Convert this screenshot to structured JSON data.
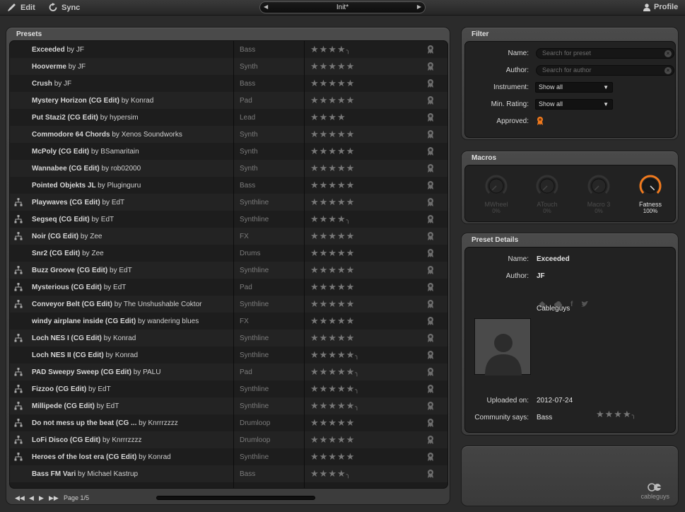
{
  "topbar": {
    "edit_label": "Edit",
    "sync_label": "Sync",
    "preset_name": "Init*",
    "profile_label": "Profile"
  },
  "presets": {
    "title": "Presets",
    "rows": [
      {
        "name": "Exceeded",
        "author": "by JF",
        "instrument": "Bass",
        "stars": "★★★★",
        "half": true,
        "tree": false
      },
      {
        "name": "Hooverme",
        "author": "by JF",
        "instrument": "Synth",
        "stars": "★★★★★",
        "half": false,
        "tree": false
      },
      {
        "name": "Crush",
        "author": "by JF",
        "instrument": "Bass",
        "stars": "★★★★★",
        "half": false,
        "tree": false
      },
      {
        "name": "Mystery Horizon (CG Edit)",
        "author": "by Konrad",
        "instrument": "Pad",
        "stars": "★★★★★",
        "half": false,
        "tree": false
      },
      {
        "name": "Put Stazi2 (CG Edit)",
        "author": "by hypersim",
        "instrument": "Lead",
        "stars": "★★★★",
        "half": false,
        "tree": false
      },
      {
        "name": "Commodore 64 Chords",
        "author": "by Xenos Soundworks",
        "instrument": "Synth",
        "stars": "★★★★★",
        "half": false,
        "tree": false
      },
      {
        "name": "McPoly (CG Edit)",
        "author": "by BSamaritain",
        "instrument": "Synth",
        "stars": "★★★★★",
        "half": false,
        "tree": false
      },
      {
        "name": "Wannabee (CG Edit)",
        "author": "by rob02000",
        "instrument": "Synth",
        "stars": "★★★★★",
        "half": false,
        "tree": false
      },
      {
        "name": "Pointed Objekts JL",
        "author": "by Pluginguru",
        "instrument": "Bass",
        "stars": "★★★★★",
        "half": false,
        "tree": false
      },
      {
        "name": "Playwaves (CG Edit)",
        "author": "by EdT",
        "instrument": "Synthline",
        "stars": "★★★★★",
        "half": false,
        "tree": true
      },
      {
        "name": "Segseq (CG Edit)",
        "author": "by EdT",
        "instrument": "Synthline",
        "stars": "★★★★",
        "half": true,
        "tree": true
      },
      {
        "name": "Noir (CG Edit)",
        "author": "by Zee",
        "instrument": "FX",
        "stars": "★★★★★",
        "half": false,
        "tree": true
      },
      {
        "name": "Snr2 (CG Edit)",
        "author": "by Zee",
        "instrument": "Drums",
        "stars": "★★★★★",
        "half": false,
        "tree": false
      },
      {
        "name": "Buzz Groove (CG Edit)",
        "author": "by EdT",
        "instrument": "Synthline",
        "stars": "★★★★★",
        "half": false,
        "tree": true
      },
      {
        "name": "Mysterious (CG Edit)",
        "author": "by EdT",
        "instrument": "Pad",
        "stars": "★★★★★",
        "half": false,
        "tree": true
      },
      {
        "name": "Conveyor Belt (CG Edit)",
        "author": "by The Unshushable Coktor",
        "instrument": "Synthline",
        "stars": "★★★★★",
        "half": false,
        "tree": true
      },
      {
        "name": "windy airplane inside (CG Edit)",
        "author": "by wandering blues",
        "instrument": "FX",
        "stars": "★★★★★",
        "half": false,
        "tree": false
      },
      {
        "name": "Loch NES I (CG Edit)",
        "author": "by Konrad",
        "instrument": "Synthline",
        "stars": "★★★★★",
        "half": false,
        "tree": true
      },
      {
        "name": "Loch NES II (CG Edit)",
        "author": "by Konrad",
        "instrument": "Synthline",
        "stars": "★★★★★",
        "half": true,
        "tree": false
      },
      {
        "name": "PAD Sweepy Sweep (CG Edit)",
        "author": "by PALU",
        "instrument": "Pad",
        "stars": "★★★★★",
        "half": true,
        "tree": true
      },
      {
        "name": "Fizzoo (CG Edit)",
        "author": "by EdT",
        "instrument": "Synthline",
        "stars": "★★★★★",
        "half": true,
        "tree": true
      },
      {
        "name": "Millipede (CG Edit)",
        "author": "by EdT",
        "instrument": "Synthline",
        "stars": "★★★★★",
        "half": true,
        "tree": true
      },
      {
        "name": "Do not mess up the beat (CG ...",
        "author": "by Knrrrzzzz",
        "instrument": "Drumloop",
        "stars": "★★★★★",
        "half": false,
        "tree": true
      },
      {
        "name": "LoFi Disco (CG Edit)",
        "author": "by Knrrrzzzz",
        "instrument": "Drumloop",
        "stars": "★★★★★",
        "half": false,
        "tree": true
      },
      {
        "name": "Heroes of the lost era (CG Edit)",
        "author": "by Konrad",
        "instrument": "Synthline",
        "stars": "★★★★★",
        "half": false,
        "tree": true
      },
      {
        "name": "Bass FM Vari",
        "author": "by Michael Kastrup",
        "instrument": "Bass",
        "stars": "★★★★",
        "half": true,
        "tree": false
      }
    ],
    "page_label": "Page 1/5"
  },
  "filter": {
    "title": "Filter",
    "name_label": "Name:",
    "name_placeholder": "Search for preset",
    "author_label": "Author:",
    "author_placeholder": "Search for author",
    "instrument_label": "Instrument:",
    "instrument_value": "Show all",
    "rating_label": "Min. Rating:",
    "rating_value": "Show all",
    "approved_label": "Approved:"
  },
  "macros": {
    "title": "Macros",
    "items": [
      {
        "name": "MWheel",
        "value": "0%",
        "level": 0
      },
      {
        "name": "ATouch",
        "value": "0%",
        "level": 0
      },
      {
        "name": "Macro 3",
        "value": "0%",
        "level": 0
      },
      {
        "name": "Fatness",
        "value": "100%",
        "level": 1
      }
    ],
    "accent": "#f07a1e"
  },
  "details": {
    "title": "Preset Details",
    "name_label": "Name:",
    "name_value": "Exceeded",
    "author_label": "Author:",
    "author_value": "JF",
    "bio": "Cableguys",
    "uploaded_label": "Uploaded on:",
    "uploaded_value": "2012-07-24",
    "community_label": "Community says:",
    "community_value": "Bass",
    "community_stars": "★★★★"
  },
  "logo": {
    "text": "cableguys"
  }
}
